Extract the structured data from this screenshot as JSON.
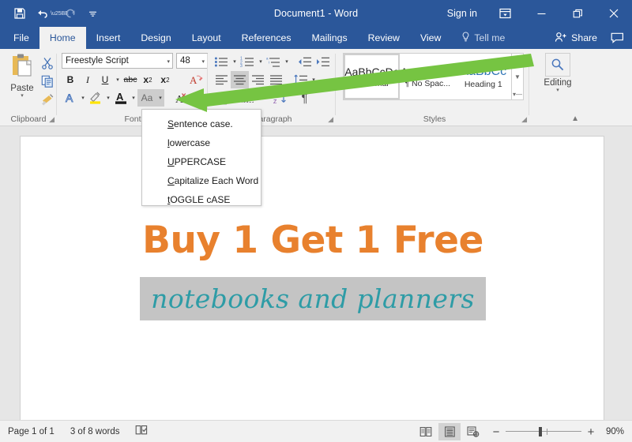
{
  "window": {
    "title": "Document1  -  Word",
    "signin": "Sign in",
    "quick_access": [
      {
        "name": "save-icon",
        "glyph": "💾"
      },
      {
        "name": "undo-icon",
        "glyph": "↶"
      },
      {
        "name": "redo-icon",
        "glyph": "↻"
      },
      {
        "name": "customize-qat-icon",
        "glyph": "≡"
      }
    ],
    "ribbon_display_options": "ribbon-display-options-icon",
    "minimize": "—",
    "restore": "❐",
    "close": "✕"
  },
  "tabs": [
    {
      "label": "File",
      "active": false
    },
    {
      "label": "Home",
      "active": true
    },
    {
      "label": "Insert",
      "active": false
    },
    {
      "label": "Design",
      "active": false
    },
    {
      "label": "Layout",
      "active": false
    },
    {
      "label": "References",
      "active": false
    },
    {
      "label": "Mailings",
      "active": false
    },
    {
      "label": "Review",
      "active": false
    },
    {
      "label": "View",
      "active": false
    }
  ],
  "tellme": "Tell me",
  "share": "Share",
  "ribbon": {
    "groups": {
      "clipboard": {
        "label": "Clipboard",
        "paste": "Paste",
        "side_buttons": [
          "cut-icon",
          "copy-icon",
          "format-painter-icon"
        ]
      },
      "font": {
        "label": "Font",
        "font_name": "Freestyle Script",
        "font_size": "48",
        "row1": [
          "Bold",
          "Italic",
          "Underline",
          "Strikethrough",
          "Subscript",
          "Superscript",
          "Text Effects and Typography"
        ],
        "row2": [
          "Text Highlight Color",
          "Font Color",
          "Change Case",
          "Clear All Formatting"
        ],
        "change_case_label": "Aa"
      },
      "paragraph": {
        "label": "Paragraph"
      },
      "styles": {
        "label": "Styles",
        "items": [
          {
            "preview": "AaBbCcDc",
            "name": "¶ Normal",
            "selected": true
          },
          {
            "preview": "AaBbCcDc",
            "name": "¶ No Spac...",
            "selected": false
          },
          {
            "preview": "AaBbCс",
            "name": "Heading 1",
            "selected": false
          }
        ]
      },
      "editing": {
        "label": "Editing"
      }
    }
  },
  "change_case_menu": {
    "items": [
      {
        "first": "S",
        "rest": "entence case."
      },
      {
        "first": "l",
        "rest": "owercase"
      },
      {
        "first": "U",
        "rest": "PPERCASE"
      },
      {
        "first": "C",
        "rest": "apitalize Each Word"
      },
      {
        "first": "t",
        "rest": "OGGLE cASE"
      }
    ]
  },
  "document": {
    "heading": "Buy 1 Get 1 Free",
    "subheading": "notebooks and planners",
    "heading_color": "#e8812e",
    "subheading_color": "#2e9ca6",
    "selection_color": "#c4c4c4"
  },
  "statusbar": {
    "page": "Page 1 of 1",
    "words": "3 of 8 words",
    "proofing": "proofing-icon",
    "views": [
      {
        "name": "read-mode-icon",
        "selected": false
      },
      {
        "name": "print-layout-icon",
        "selected": true
      },
      {
        "name": "web-layout-icon",
        "selected": false
      }
    ],
    "zoom_out": "−",
    "zoom_in": "+",
    "zoom_level": "90%"
  },
  "annotation": {
    "arrow_color": "#76c442"
  }
}
